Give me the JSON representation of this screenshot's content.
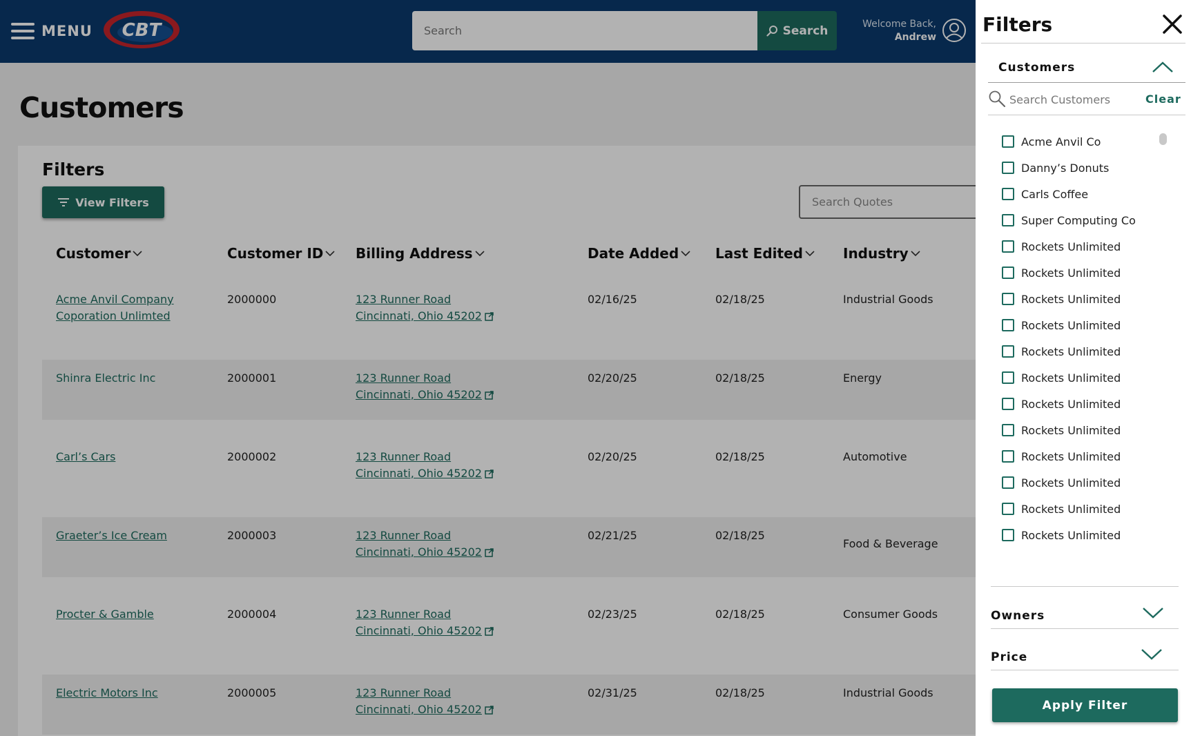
{
  "header": {
    "menu_label": "MENU",
    "logo_text": "CBT",
    "search_placeholder": "Search",
    "search_button": "Search",
    "welcome_line": "Welcome Back,",
    "user_name": "Andrew",
    "icons": {
      "menu": "hamburger-icon",
      "search": "magnifier-icon",
      "user": "user-circle-icon"
    }
  },
  "page": {
    "title": "Customers",
    "filters_heading": "Filters",
    "view_filters_button": "View Filters",
    "quotes_search_placeholder": "Search Quotes"
  },
  "table": {
    "columns": [
      "Customer",
      "Customer ID",
      "Billing Address",
      "Date Added",
      "Last Edited",
      "Industry"
    ],
    "rows": [
      {
        "customer": [
          "Acme Anvil Company",
          "Coporation Unlimted"
        ],
        "id": "2000000",
        "address": [
          "123 Runner Road",
          "Cincinnati, Ohio 45202"
        ],
        "date_added": "02/16/25",
        "last_edited": "02/18/25",
        "industry": "Industrial Goods"
      },
      {
        "customer": [
          "Shinra Electric Inc"
        ],
        "id": "2000001",
        "address": [
          "123 Runner Road",
          "Cincinnati, Ohio 45202"
        ],
        "date_added": "02/20/25",
        "last_edited": "02/18/25",
        "industry": "Energy"
      },
      {
        "customer": [
          "Carl’s Cars"
        ],
        "id": "2000002",
        "address": [
          "123 Runner Road",
          "Cincinnati, Ohio 45202"
        ],
        "date_added": "02/20/25",
        "last_edited": "02/18/25",
        "industry": "Automotive"
      },
      {
        "customer": [
          "Graeter’s Ice Cream"
        ],
        "id": "2000003",
        "address": [
          "123 Runner Road",
          "Cincinnati, Ohio 45202"
        ],
        "date_added": "02/21/25",
        "last_edited": "02/18/25",
        "industry": "Food & Beverage"
      },
      {
        "customer": [
          "Procter & Gamble"
        ],
        "id": "2000004",
        "address": [
          "123 Runner Road",
          "Cincinnati, Ohio 45202"
        ],
        "date_added": "02/23/25",
        "last_edited": "02/18/25",
        "industry": "Consumer Goods"
      },
      {
        "customer": [
          "Electric Motors Inc"
        ],
        "id": "2000005",
        "address": [
          "123 Runner Road",
          "Cincinnati, Ohio 45202"
        ],
        "date_added": "02/31/25",
        "last_edited": "02/18/25",
        "industry": "Industrial Goods"
      }
    ]
  },
  "drawer": {
    "title": "Filters",
    "customers_section": {
      "label": "Customers",
      "search_placeholder": "Search Customers",
      "clear_label": "Clear",
      "expanded": true,
      "items": [
        "Acme Anvil Co",
        "Danny’s Donuts",
        "Carls Coffee",
        "Super Computing Co",
        "Rockets Unlimited",
        "Rockets Unlimited",
        "Rockets Unlimited",
        "Rockets Unlimited",
        "Rockets Unlimited",
        "Rockets Unlimited",
        "Rockets Unlimited",
        "Rockets Unlimited",
        "Rockets Unlimited",
        "Rockets Unlimited",
        "Rockets Unlimited",
        "Rockets Unlimited"
      ]
    },
    "owners_label": "Owners",
    "price_label": "Price",
    "apply_button": "Apply Filter"
  },
  "colors": {
    "header_bg": "#0b3a6e",
    "accent_green": "#1d6a5e",
    "logo_red": "#c8252c"
  }
}
